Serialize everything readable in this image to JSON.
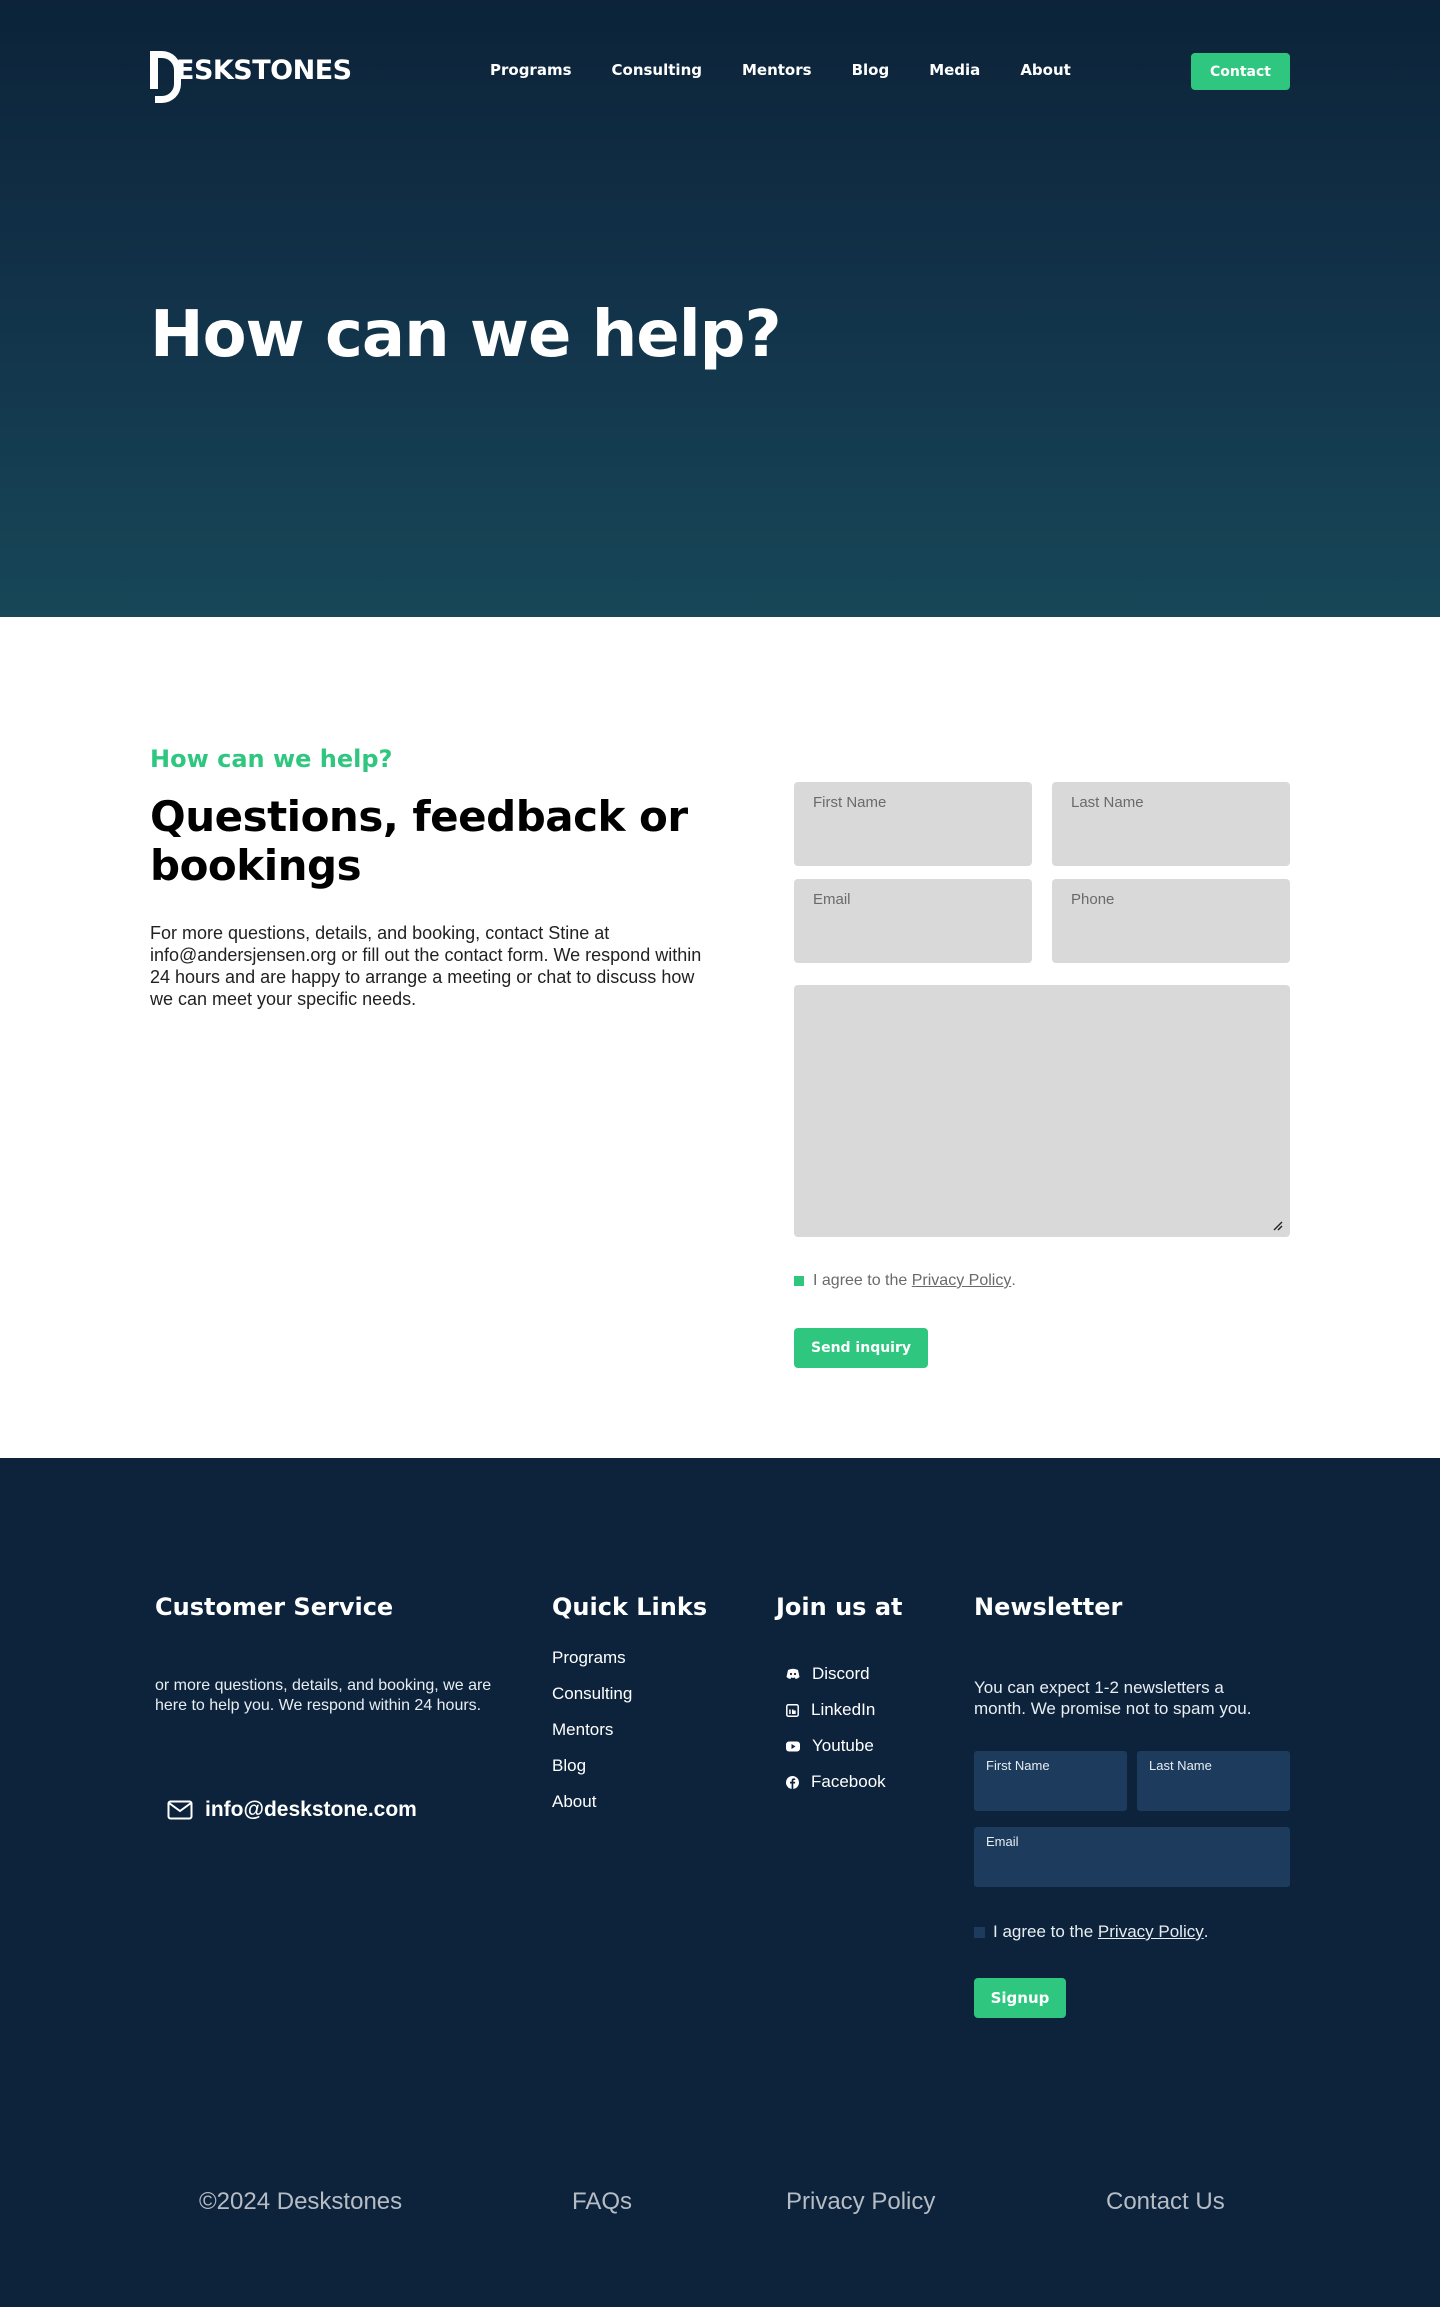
{
  "header": {
    "logo_text": "ESKSTONES",
    "nav": [
      "Programs",
      "Consulting",
      "Mentors",
      "Blog",
      "Media",
      "About"
    ],
    "contact_label": "Contact"
  },
  "hero": {
    "title": "How can we help?"
  },
  "contact": {
    "kicker": "How can we help?",
    "title": "Questions, feedback or bookings",
    "body": "For more questions, details, and booking, contact Stine at info@andersjensen.org or fill out the contact form. We respond within 24 hours and are happy to arrange a meeting or chat to discuss how we can meet your specific needs.",
    "form": {
      "first_name": "First Name",
      "last_name": "Last Name",
      "email": "Email",
      "phone": "Phone",
      "agree_prefix": "I agree to the ",
      "agree_link": "Privacy Policy",
      "agree_suffix": ".",
      "submit": "Send inquiry"
    }
  },
  "footer": {
    "customer_service": {
      "title": "Customer Service",
      "body": "or more questions, details, and booking, we are here to help you. We respond within 24 hours.",
      "email": "info@deskstone.com"
    },
    "quick_links": {
      "title": "Quick Links",
      "items": [
        "Programs",
        "Consulting",
        "Mentors",
        "Blog",
        "About"
      ]
    },
    "join": {
      "title": "Join us at",
      "items": [
        {
          "label": "Discord",
          "icon": "discord-icon"
        },
        {
          "label": "LinkedIn",
          "icon": "linkedin-icon"
        },
        {
          "label": "Youtube",
          "icon": "youtube-icon"
        },
        {
          "label": "Facebook",
          "icon": "facebook-icon"
        }
      ]
    },
    "newsletter": {
      "title": "Newsletter",
      "body": "You can expect 1-2 newsletters a month. We promise not to spam you.",
      "first_name": "First Name",
      "last_name": "Last Name",
      "email": "Email",
      "agree_prefix": "I agree to the ",
      "agree_link": "Privacy Policy",
      "agree_suffix": ".",
      "submit": "Signup"
    },
    "bottom": {
      "copyright": "©2024 Deskstones",
      "faqs": "FAQs",
      "privacy": "Privacy Policy",
      "contact": "Contact Us"
    }
  },
  "colors": {
    "accent": "#2fc77f",
    "navy": "#0c233b",
    "field": "#d9d9d9"
  }
}
